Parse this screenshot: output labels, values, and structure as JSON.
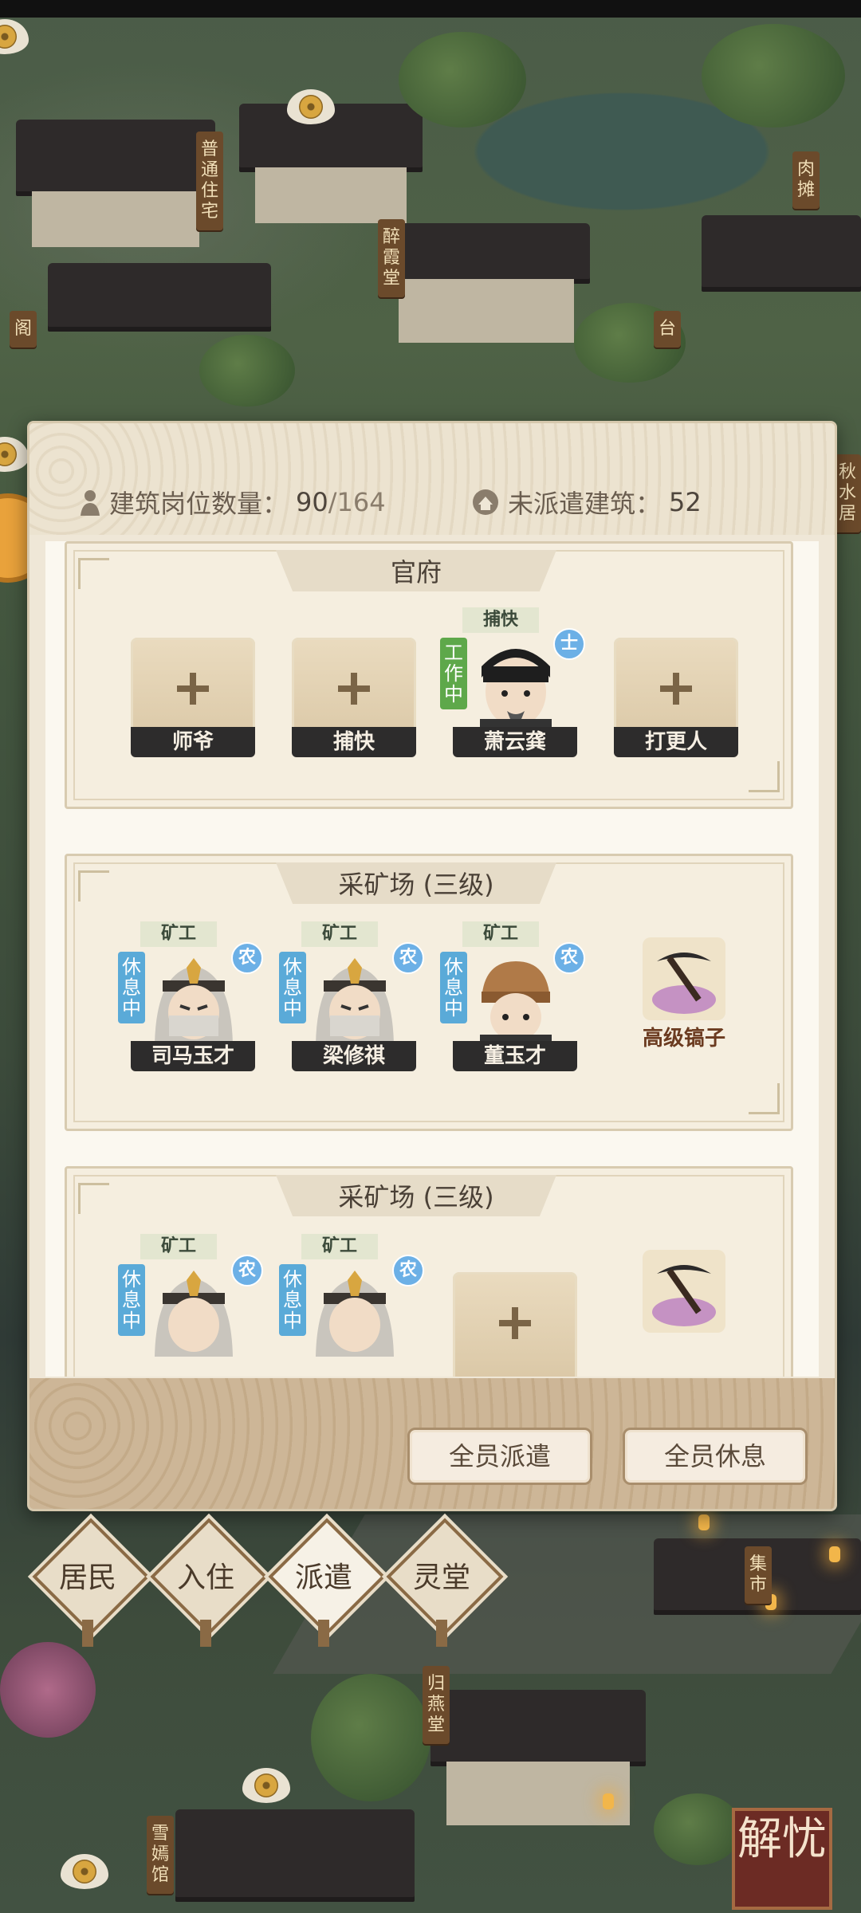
{
  "background": {
    "signs": [
      "普通住宅",
      "醉霞堂",
      "肉摊",
      "阁",
      "台",
      "秋水居",
      "集市",
      "归燕堂",
      "雪嫣馆"
    ],
    "bottom_right_button": "解忧"
  },
  "dialog": {
    "stats": {
      "posts_label": "建筑岗位数量：",
      "posts_value": "90",
      "posts_total": "/164",
      "unassigned_label": "未派遣建筑：",
      "unassigned_value": "52"
    },
    "buildings": [
      {
        "title": "官府",
        "slots": [
          {
            "label": "师爷",
            "empty": true
          },
          {
            "label": "捕快",
            "empty": true
          },
          {
            "label": "萧云龚",
            "job": "捕快",
            "status": "工作中",
            "badge": "士"
          },
          {
            "label": "打更人",
            "empty": true
          }
        ]
      },
      {
        "title": "采矿场 (三级)",
        "slots": [
          {
            "label": "司马玉才",
            "job": "矿工",
            "status": "休息中",
            "badge": "农"
          },
          {
            "label": "梁修祺",
            "job": "矿工",
            "status": "休息中",
            "badge": "农"
          },
          {
            "label": "董玉才",
            "job": "矿工",
            "status": "休息中",
            "badge": "农"
          }
        ],
        "tool": "高级镐子"
      },
      {
        "title": "采矿场 (三级)",
        "slots": [
          {
            "job": "矿工",
            "status": "休息中",
            "badge": "农"
          },
          {
            "job": "矿工",
            "status": "休息中",
            "badge": "农"
          }
        ]
      }
    ],
    "buttons": {
      "dispatch_all": "全员派遣",
      "rest_all": "全员休息"
    }
  },
  "menu": [
    "居民",
    "入住",
    "派遣",
    "灵堂"
  ],
  "colors": {
    "work_status": "#5ea84a",
    "rest_status": "#5aaad8",
    "badge": "#6cb0e6",
    "panel": "#efe7d7"
  }
}
